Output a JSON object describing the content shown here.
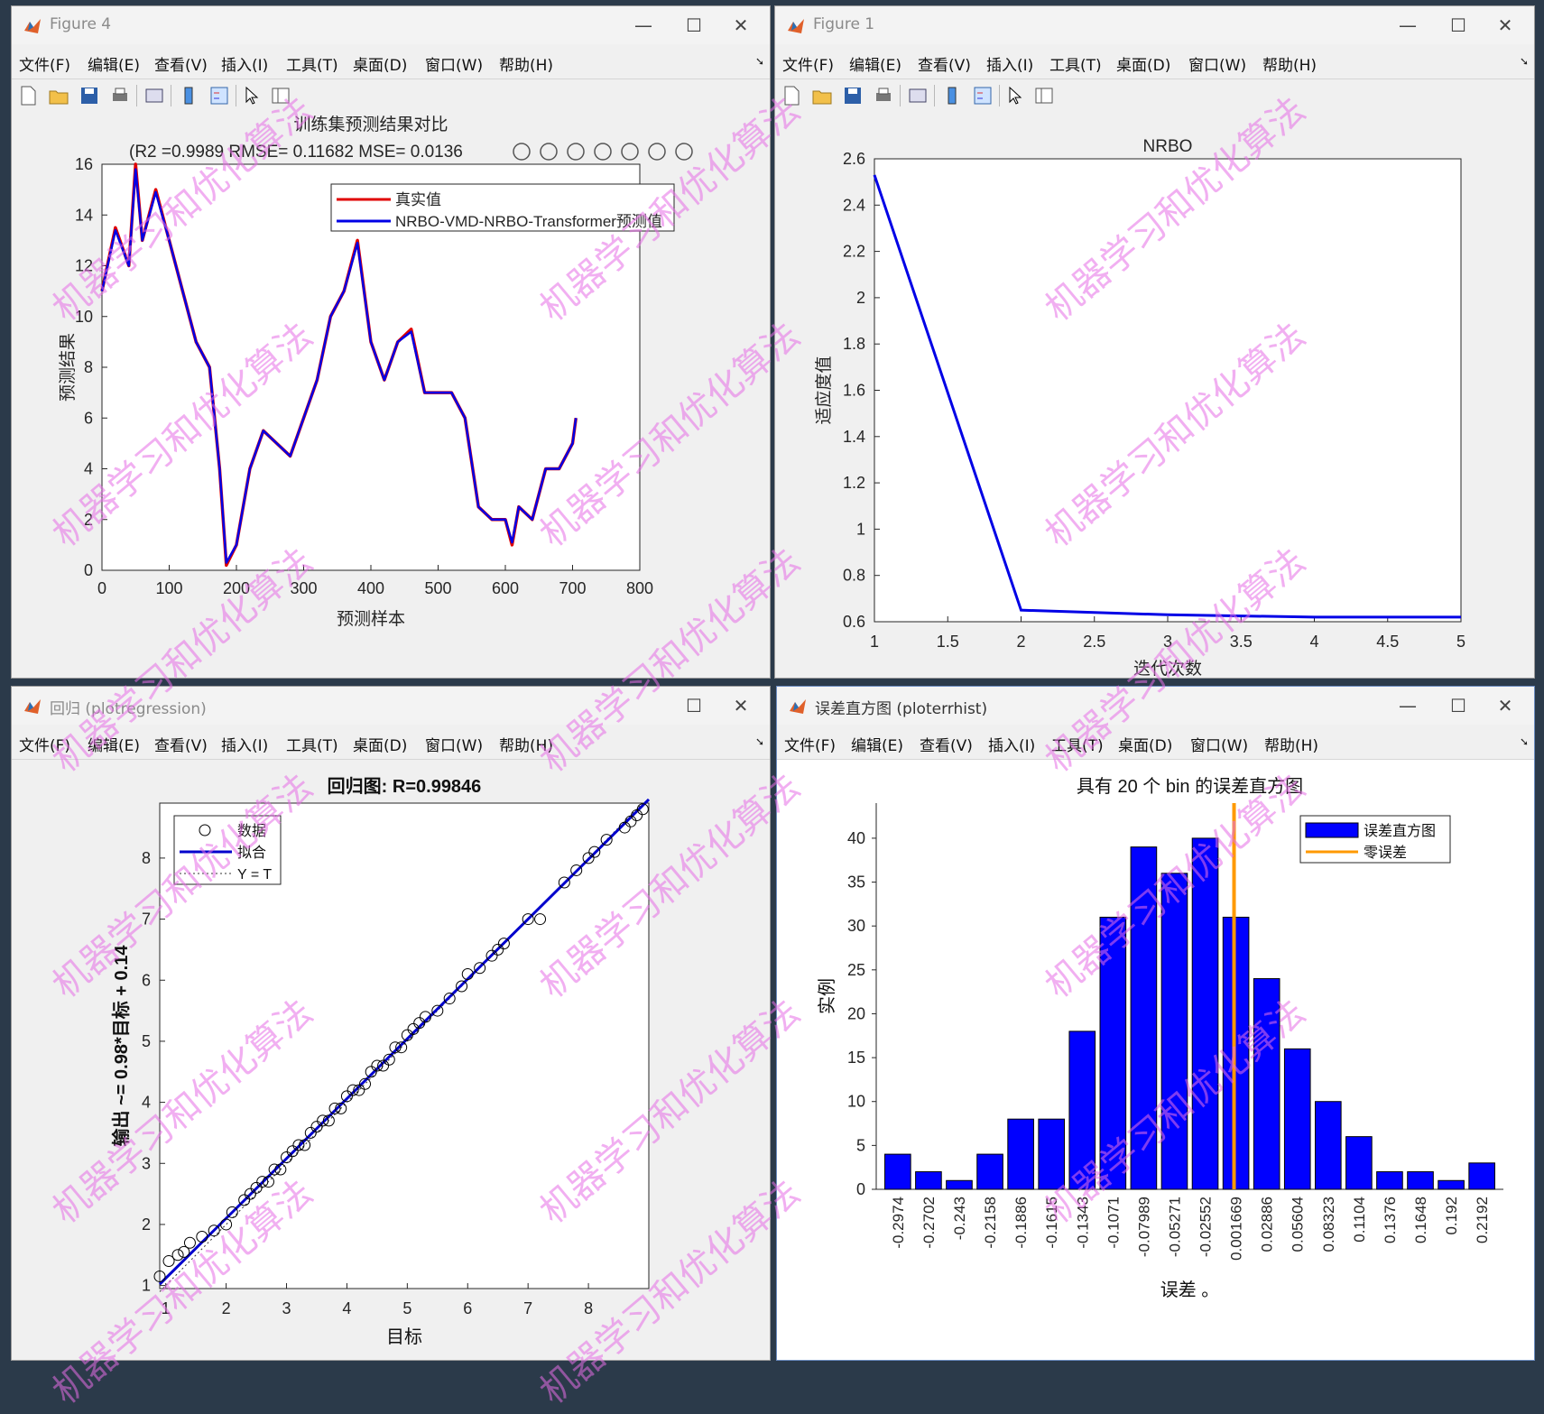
{
  "windows": {
    "fig4": {
      "title": "Figure 4",
      "menus": [
        "文件(F)",
        "编辑(E)",
        "查看(V)",
        "插入(I)",
        "工具(T)",
        "桌面(D)",
        "窗口(W)",
        "帮助(H)"
      ],
      "plot_title_line1": "训练集预测结果对比",
      "plot_title_line2": "(R2 =0.9989 RMSE= 0.11682 MSE= 0.0136",
      "xlabel": "预测样本",
      "ylabel": "预测结果",
      "legend": [
        "真实值",
        "NRBO-VMD-NRBO-Transformer预测值"
      ]
    },
    "fig1": {
      "title": "Figure 1",
      "menus": [
        "文件(F)",
        "编辑(E)",
        "查看(V)",
        "插入(I)",
        "工具(T)",
        "桌面(D)",
        "窗口(W)",
        "帮助(H)"
      ],
      "plot_title": "NRBO",
      "xlabel": "迭代次数",
      "ylabel": "适应度值"
    },
    "regression": {
      "title": "回归 (plotregression)",
      "menus": [
        "文件(F)",
        "编辑(E)",
        "查看(V)",
        "插入(I)",
        "工具(T)",
        "桌面(D)",
        "窗口(W)",
        "帮助(H)"
      ],
      "plot_title": "回归图: R=0.99846",
      "xlabel": "目标",
      "ylabel": "输出 ~= 0.98*目标 + 0.14",
      "legend": [
        "数据",
        "拟合",
        "Y = T"
      ]
    },
    "errhist": {
      "title": "误差直方图 (ploterrhist)",
      "menus": [
        "文件(F)",
        "编辑(E)",
        "查看(V)",
        "插入(I)",
        "工具(T)",
        "桌面(D)",
        "窗口(W)",
        "帮助(H)"
      ],
      "plot_title": "具有 20 个 bin 的误差直方图",
      "xlabel": "误差 。",
      "ylabel": "实例",
      "legend": [
        "误差直方图",
        "零误差"
      ]
    }
  },
  "watermark": "机器学习和优化算法",
  "colors": {
    "true_series": "#e00000",
    "pred_series": "#0000e6",
    "bar": "#0000ff",
    "zero_line": "#ff9900",
    "fit": "#0000cc"
  },
  "chart_data": [
    {
      "type": "line",
      "title": "训练集预测结果对比",
      "xlabel": "预测样本",
      "ylabel": "预测结果",
      "xlim": [
        0,
        800
      ],
      "ylim": [
        0,
        16
      ],
      "xticks": [
        0,
        100,
        200,
        300,
        400,
        500,
        600,
        700,
        800
      ],
      "yticks": [
        0,
        2,
        4,
        6,
        8,
        10,
        12,
        14,
        16
      ],
      "x": [
        0,
        20,
        40,
        50,
        60,
        80,
        100,
        120,
        140,
        160,
        175,
        185,
        200,
        220,
        240,
        260,
        280,
        300,
        320,
        340,
        360,
        380,
        400,
        420,
        440,
        460,
        480,
        500,
        520,
        540,
        560,
        580,
        600,
        610,
        620,
        640,
        660,
        680,
        700,
        705
      ],
      "series": [
        {
          "name": "真实值",
          "values": [
            11,
            13.5,
            12,
            16,
            13,
            15,
            13,
            11,
            9,
            8,
            4,
            0.2,
            1,
            4,
            5.5,
            5,
            4.5,
            6,
            7.5,
            10,
            11,
            13,
            9,
            7.5,
            9,
            9.5,
            7,
            7,
            7,
            6,
            2.5,
            2,
            2,
            1,
            2.5,
            2,
            4,
            4,
            5,
            6
          ]
        },
        {
          "name": "NRBO-VMD-NRBO-Transformer预测值",
          "values": [
            11,
            13.4,
            12,
            15.8,
            13,
            14.9,
            13,
            11,
            9,
            8,
            4,
            0.3,
            1,
            4,
            5.5,
            5,
            4.5,
            6,
            7.5,
            10,
            11,
            12.9,
            9,
            7.5,
            9,
            9.4,
            7,
            7,
            7,
            6,
            2.5,
            2,
            2,
            1.1,
            2.5,
            2,
            4,
            4,
            5,
            6
          ]
        }
      ]
    },
    {
      "type": "line",
      "title": "NRBO",
      "xlabel": "迭代次数",
      "ylabel": "适应度值",
      "xlim": [
        1,
        5
      ],
      "ylim": [
        0.6,
        2.6
      ],
      "xticks": [
        1,
        1.5,
        2,
        2.5,
        3,
        3.5,
        4,
        4.5,
        5
      ],
      "yticks": [
        0.6,
        0.8,
        1,
        1.2,
        1.4,
        1.6,
        1.8,
        2,
        2.2,
        2.4,
        2.6
      ],
      "x": [
        1,
        2,
        3,
        4,
        5
      ],
      "series": [
        {
          "values": [
            2.53,
            0.65,
            0.63,
            0.62,
            0.62
          ]
        }
      ]
    },
    {
      "type": "scatter",
      "title": "回归图: R=0.99846",
      "xlabel": "目标",
      "ylabel": "输出 ~= 0.98*目标 + 0.14",
      "xlim": [
        0.9,
        9.0
      ],
      "ylim": [
        0.95,
        8.9
      ],
      "xticks": [
        1,
        2,
        3,
        4,
        5,
        6,
        7,
        8
      ],
      "yticks": [
        1,
        2,
        3,
        4,
        5,
        6,
        7,
        8
      ],
      "fit": {
        "slope": 0.98,
        "intercept": 0.14
      },
      "points": [
        [
          0.9,
          1.15
        ],
        [
          1.05,
          1.4
        ],
        [
          1.2,
          1.5
        ],
        [
          1.3,
          1.55
        ],
        [
          1.4,
          1.7
        ],
        [
          1.6,
          1.8
        ],
        [
          1.8,
          1.9
        ],
        [
          2.0,
          2.0
        ],
        [
          2.1,
          2.2
        ],
        [
          2.3,
          2.4
        ],
        [
          2.4,
          2.5
        ],
        [
          2.5,
          2.6
        ],
        [
          2.6,
          2.7
        ],
        [
          2.7,
          2.7
        ],
        [
          2.8,
          2.9
        ],
        [
          2.9,
          2.9
        ],
        [
          3.0,
          3.1
        ],
        [
          3.1,
          3.2
        ],
        [
          3.2,
          3.3
        ],
        [
          3.3,
          3.3
        ],
        [
          3.4,
          3.5
        ],
        [
          3.5,
          3.6
        ],
        [
          3.6,
          3.7
        ],
        [
          3.7,
          3.7
        ],
        [
          3.8,
          3.9
        ],
        [
          3.9,
          3.9
        ],
        [
          4.0,
          4.1
        ],
        [
          4.1,
          4.2
        ],
        [
          4.2,
          4.2
        ],
        [
          4.3,
          4.3
        ],
        [
          4.4,
          4.5
        ],
        [
          4.5,
          4.6
        ],
        [
          4.6,
          4.6
        ],
        [
          4.7,
          4.7
        ],
        [
          4.8,
          4.9
        ],
        [
          4.9,
          4.9
        ],
        [
          5.0,
          5.1
        ],
        [
          5.1,
          5.2
        ],
        [
          5.2,
          5.3
        ],
        [
          5.3,
          5.4
        ],
        [
          5.5,
          5.5
        ],
        [
          5.7,
          5.7
        ],
        [
          5.9,
          5.9
        ],
        [
          6.0,
          6.1
        ],
        [
          6.2,
          6.2
        ],
        [
          6.4,
          6.4
        ],
        [
          6.5,
          6.5
        ],
        [
          6.6,
          6.6
        ],
        [
          7.0,
          7.0
        ],
        [
          7.2,
          7.0
        ],
        [
          7.6,
          7.6
        ],
        [
          7.8,
          7.8
        ],
        [
          8.0,
          8.0
        ],
        [
          8.1,
          8.1
        ],
        [
          8.3,
          8.3
        ],
        [
          8.6,
          8.5
        ],
        [
          8.7,
          8.6
        ],
        [
          8.8,
          8.7
        ],
        [
          8.9,
          8.8
        ]
      ]
    },
    {
      "type": "bar",
      "title": "具有 20 个 bin 的误差直方图",
      "xlabel": "误差 。",
      "ylabel": "实例",
      "ylim": [
        0,
        44
      ],
      "yticks": [
        0,
        5,
        10,
        15,
        20,
        25,
        30,
        35,
        40
      ],
      "categories": [
        "-0.2974",
        "-0.2702",
        "-0.243",
        "-0.2158",
        "-0.1886",
        "-0.1615",
        "-0.1343",
        "-0.1071",
        "-0.07989",
        "-0.05271",
        "-0.02552",
        "0.001669",
        "0.02886",
        "0.05604",
        "0.08323",
        "0.1104",
        "0.1376",
        "0.1648",
        "0.192",
        "0.2192"
      ],
      "values": [
        4,
        2,
        1,
        4,
        8,
        8,
        18,
        31,
        39,
        36,
        40,
        31,
        24,
        16,
        10,
        6,
        2,
        2,
        1,
        3
      ],
      "zero_error_x": 0
    }
  ]
}
